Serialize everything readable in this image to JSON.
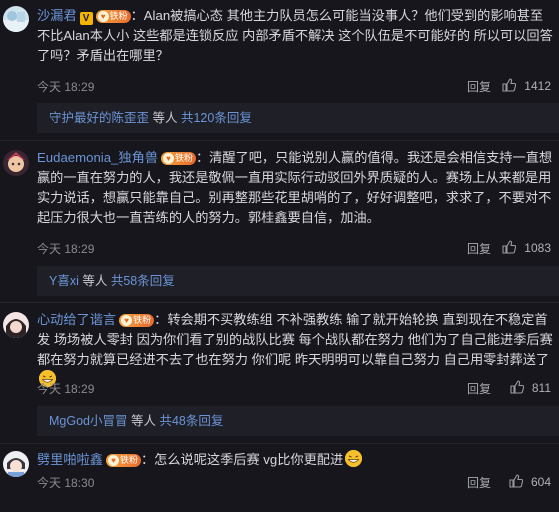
{
  "comments": [
    {
      "username": "沙漏君",
      "vip_badge": "V",
      "fan_level": "铁粉",
      "text": "：Alan被搞心态 其他主力队员怎么可能当没事人？他们受到的影响甚至不比Alan本人小 这些都是连锁反应 内部矛盾不解决 这个队伍是不可能好的 所以可以回答了吗？矛盾出在哪里？",
      "time": "今天 18:29",
      "reply_label": "回复",
      "likes": "1412",
      "sub": {
        "who": "守护最好的陈歪歪",
        "mid": " 等人 ",
        "count": "共120条回复"
      }
    },
    {
      "username": "Eudaemonia_独角兽",
      "fan_level": "铁粉",
      "text": "：清醒了吧，只能说别人赢的值得。我还是会相信支持一直想赢的一直在努力的人，我还是敬佩一直用实际行动驳回外界质疑的人。赛场上从来都是用实力说话，想赢只能靠自己。别再整那些花里胡哨的了，好好调整吧，求求了，不要对不起压力很大也一直苦练的人的努力。郭桂鑫要自信，加油。",
      "time": "今天 18:29",
      "reply_label": "回复",
      "likes": "1083",
      "sub": {
        "who": "Y喜xi",
        "mid": " 等人 ",
        "count": "共58条回复"
      }
    },
    {
      "username": "心动给了谐言",
      "fan_level": "铁粉",
      "text": "：转会期不买教练组 不补强教练 输了就开始轮换 直到现在不稳定首发 场场被人零封 因为你们看了别的战队比赛 每个战队都在努力 他们为了自己能进季后赛都在努力就算已经进不去了也在努力 你们呢 昨天明明可以靠自己努力 自己用零封葬送了",
      "time": "今天 18:29",
      "reply_label": "回复",
      "likes": "811",
      "sub": {
        "who": "MgGod小冒冒",
        "mid": " 等人 ",
        "count": "共48条回复"
      }
    },
    {
      "username": "劈里啪啦鑫",
      "fan_level": "铁粉",
      "text": "：怎么说呢这季后赛 vg比你更配进",
      "time": "今天 18:30",
      "reply_label": "回复",
      "likes": "604"
    }
  ],
  "colors": {
    "background": "#16161c",
    "username": "#6b95d6",
    "text": "#d7d7dc",
    "meta": "#8a8a92",
    "sub_background": "#1f1f27"
  },
  "icons": [
    "avatar",
    "vip-badge",
    "fan-badge",
    "thumb-up-icon",
    "grin-emoji"
  ]
}
